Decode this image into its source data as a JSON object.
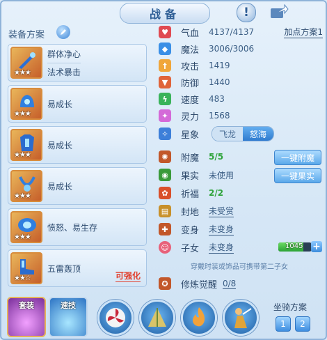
{
  "title": "战备",
  "left": {
    "scheme_label": "装备方案",
    "items": [
      {
        "line1": "群体净心",
        "line2": "法术暴击",
        "stars": "★★★",
        "tag": ""
      },
      {
        "line1": "易成长",
        "line2": "",
        "stars": "★★★",
        "tag": ""
      },
      {
        "line1": "易成长",
        "line2": "",
        "stars": "★★★",
        "tag": ""
      },
      {
        "line1": "易成长",
        "line2": "",
        "stars": "★★★",
        "tag": ""
      },
      {
        "line1": "愤怒、易生存",
        "line2": "",
        "stars": "★★★",
        "tag": ""
      },
      {
        "line1": "五雷轰顶",
        "line2": "",
        "stars": "★★☆",
        "tag": "可强化"
      }
    ]
  },
  "stats": {
    "plan_button": "加点方案1",
    "rows": [
      {
        "name": "气血",
        "value": "4137/4137",
        "color": "#e04a52"
      },
      {
        "name": "魔法",
        "value": "3006/3006",
        "color": "#3a8fe6"
      },
      {
        "name": "攻击",
        "value": "1419",
        "color": "#f0a63a"
      },
      {
        "name": "防御",
        "value": "1440",
        "color": "#e0643a"
      },
      {
        "name": "速度",
        "value": "483",
        "color": "#3ab35a"
      },
      {
        "name": "灵力",
        "value": "1568",
        "color": "#d46ad8"
      }
    ],
    "star_sign": {
      "name": "星象",
      "options": [
        "飞龙",
        "怒海"
      ],
      "selected": "怒海"
    },
    "extra": [
      {
        "name": "附魔",
        "value": "5/5",
        "style": "green"
      },
      {
        "name": "果实",
        "value": "未使用",
        "style": "plain"
      },
      {
        "name": "祈福",
        "value": "2/2",
        "style": "green"
      },
      {
        "name": "封地",
        "value": "未受赏",
        "style": "ul"
      },
      {
        "name": "变身",
        "value": "未变身",
        "style": "ul"
      },
      {
        "name": "子女",
        "value": "未变身",
        "style": "ul"
      }
    ],
    "enchant_button": "一键附魔",
    "fruit_button": "一键果实",
    "child_gauge": {
      "value": "1045",
      "fraction": 0.75
    },
    "hint": "穿戴时装或饰品可携带第二子女",
    "awaken": {
      "name": "修炼觉醒",
      "value": "0/8"
    }
  },
  "bottom": {
    "tabs": [
      "套装",
      "速技"
    ],
    "mount_label": "坐骑方案",
    "mount_buttons": [
      "1",
      "2"
    ]
  }
}
